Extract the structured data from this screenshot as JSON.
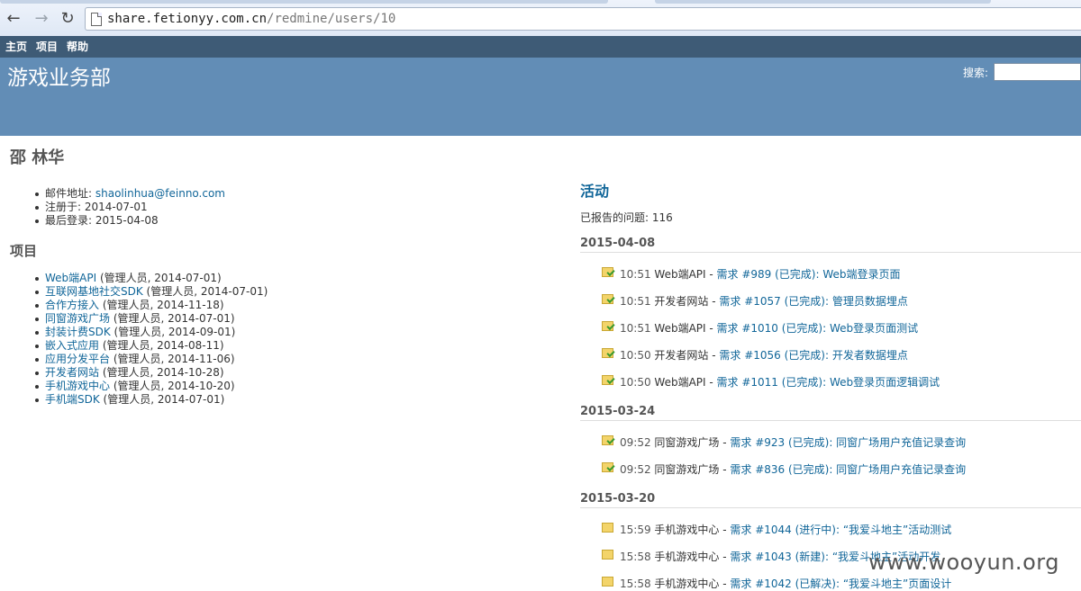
{
  "browser": {
    "url_host": "share.fetionyy.com.cn",
    "url_path": "/redmine/users/10"
  },
  "topmenu": {
    "home": "主页",
    "projects": "项目",
    "help": "帮助"
  },
  "header": {
    "title": "游戏业务部",
    "search_label": "搜索:"
  },
  "user": {
    "name": "邵 林华",
    "email_label": "邮件地址:",
    "email": "shaolinhua@feinno.com",
    "registered_label": "注册于:",
    "registered": "2014-07-01",
    "last_login_label": "最后登录:",
    "last_login": "2015-04-08"
  },
  "projects": {
    "heading": "项目",
    "items": [
      {
        "name": "Web端API",
        "detail": "(管理人员, 2014-07-01)"
      },
      {
        "name": "互联网基地社交SDK",
        "detail": "(管理人员, 2014-07-01)"
      },
      {
        "name": "合作方接入",
        "detail": "(管理人员, 2014-11-18)"
      },
      {
        "name": "同窗游戏广场",
        "detail": "(管理人员, 2014-07-01)"
      },
      {
        "name": "封装计费SDK",
        "detail": "(管理人员, 2014-09-01)"
      },
      {
        "name": "嵌入式应用",
        "detail": "(管理人员, 2014-08-11)"
      },
      {
        "name": "应用分发平台",
        "detail": "(管理人员, 2014-11-06)"
      },
      {
        "name": "开发者网站",
        "detail": "(管理人员, 2014-10-28)"
      },
      {
        "name": "手机游戏中心",
        "detail": "(管理人员, 2014-10-20)"
      },
      {
        "name": "手机端SDK",
        "detail": "(管理人员, 2014-07-01)"
      }
    ]
  },
  "activity": {
    "heading": "活动",
    "reported_label": "已报告的问题:",
    "reported_count": "116",
    "days": [
      {
        "date": "2015-04-08",
        "items": [
          {
            "time": "10:51",
            "project": "Web端API",
            "link": "需求 #989 (已完成): Web端登录页面",
            "icon": "issue-closed-icon"
          },
          {
            "time": "10:51",
            "project": "开发者网站",
            "link": "需求 #1057 (已完成): 管理员数据埋点",
            "icon": "issue-closed-icon"
          },
          {
            "time": "10:51",
            "project": "Web端API",
            "link": "需求 #1010 (已完成): Web登录页面测试",
            "icon": "issue-closed-icon"
          },
          {
            "time": "10:50",
            "project": "开发者网站",
            "link": "需求 #1056 (已完成): 开发者数据埋点",
            "icon": "issue-closed-icon"
          },
          {
            "time": "10:50",
            "project": "Web端API",
            "link": "需求 #1011 (已完成): Web登录页面逻辑调试",
            "icon": "issue-closed-icon"
          }
        ]
      },
      {
        "date": "2015-03-24",
        "items": [
          {
            "time": "09:52",
            "project": "同窗游戏广场",
            "link": "需求 #923 (已完成): 同窗广场用户充值记录查询",
            "icon": "issue-closed-icon"
          },
          {
            "time": "09:52",
            "project": "同窗游戏广场",
            "link": "需求 #836 (已完成): 同窗广场用户充值记录查询",
            "icon": "issue-closed-icon"
          }
        ]
      },
      {
        "date": "2015-03-20",
        "items": [
          {
            "time": "15:59",
            "project": "手机游戏中心",
            "link": "需求 #1044 (进行中): “我爱斗地主”活动测试",
            "icon": "issue-icon"
          },
          {
            "time": "15:58",
            "project": "手机游戏中心",
            "link": "需求 #1043 (新建): “我爱斗地主”活动开发",
            "icon": "issue-icon"
          },
          {
            "time": "15:58",
            "project": "手机游戏中心",
            "link": "需求 #1042 (已解决): “我爱斗地主”页面设计",
            "icon": "issue-icon"
          }
        ]
      }
    ]
  },
  "watermark": "www.wooyun.org"
}
